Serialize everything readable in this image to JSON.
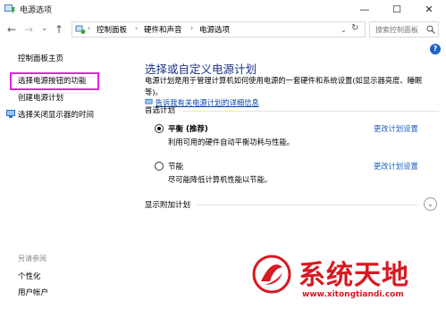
{
  "window": {
    "title": "电源选项",
    "min_glyph": "—",
    "max_glyph": "☐",
    "close_glyph": "✕"
  },
  "nav": {
    "back_glyph": "←",
    "forward_glyph": "→",
    "recent_glyph": "⌄",
    "up_glyph": "↑",
    "breadcrumbs": [
      "控制面板",
      "硬件和声音",
      "电源选项"
    ],
    "separator_glyph": "›",
    "dropdown_glyph": "⌄",
    "refresh_glyph": "↻",
    "search_placeholder": "搜索控制面板"
  },
  "help_glyph": "?",
  "sidebar": {
    "items": [
      {
        "label": "控制面板主页"
      },
      {
        "label": "选择电源按钮的功能"
      },
      {
        "label": "创建电源计划"
      },
      {
        "label": "选择关闭显示器的时间"
      }
    ],
    "see_also_label": "另请参阅",
    "see_also_items": [
      {
        "label": "个性化"
      },
      {
        "label": "用户帐户"
      }
    ]
  },
  "main": {
    "heading": "选择或自定义电源计划",
    "description": "电源计划是用于管理计算机如何使用电源的一套硬件和系统设置(如显示器亮度、睡眠等)。",
    "description_link": "告诉我有关电源计划的详细信息",
    "preferred_label": "首选计划",
    "plans": [
      {
        "name": "平衡 (推荐)",
        "desc": "利用可用的硬件自动平衡功耗与性能。",
        "change_link": "更改计划设置",
        "selected": true
      },
      {
        "name": "节能",
        "desc": "尽可能降低计算机性能以节能。",
        "change_link": "更改计划设置",
        "selected": false
      }
    ],
    "more_label": "显示附加计划",
    "expand_glyph": "⌄"
  },
  "watermark": {
    "text": "系统天地",
    "url": "www.xitongtiandi.com"
  },
  "colors": {
    "heading": "#1e3287",
    "link": "#1a5dbc",
    "highlight": "#e321e3",
    "watermark": "#d71920"
  }
}
